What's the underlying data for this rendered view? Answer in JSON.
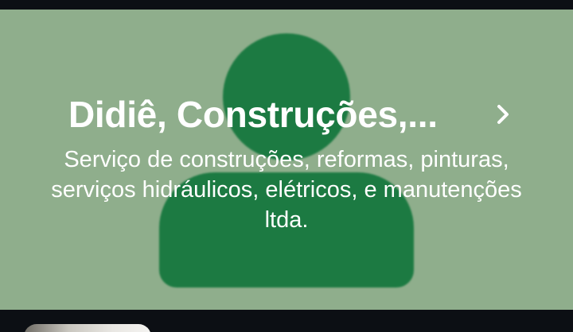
{
  "profile": {
    "name": "Didiê, Construções,...",
    "description": "Serviço de construções, reformas, pinturas, serviços hidráulicos, elétricos, e manutenções ltda.",
    "open_icon": "chevron-right-icon",
    "avatar_icon": "person-placeholder-icon"
  },
  "colors": {
    "card_background": "#8fae8c",
    "avatar": "#1c7a42",
    "text": "#ffffff",
    "frame": "#0c0f14"
  }
}
